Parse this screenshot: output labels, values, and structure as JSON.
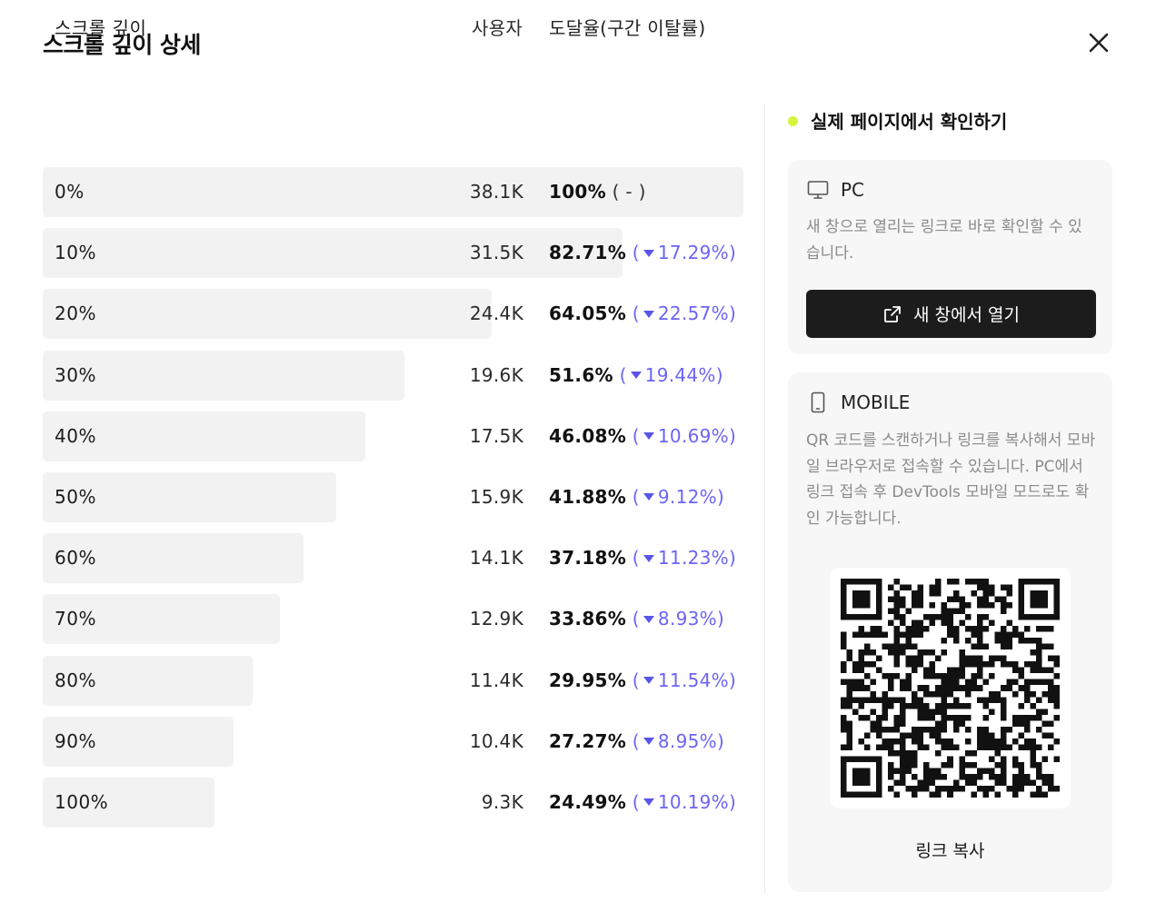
{
  "modal": {
    "title": "스크롤 깊이 상세",
    "close_icon": "close-icon"
  },
  "table": {
    "headers": {
      "depth": "스크롤 깊이",
      "users": "사용자",
      "rate": "도달율(구간 이탈률)"
    },
    "rows": [
      {
        "depth": "0%",
        "users": "38.1K",
        "reach": "100%",
        "drop": "( - )",
        "drop_has_arrow": false,
        "reach_fraction": 1.0
      },
      {
        "depth": "10%",
        "users": "31.5K",
        "reach": "82.71%",
        "drop_open": "(",
        "drop_value": "17.29%",
        "drop_close": ")",
        "drop_has_arrow": true,
        "reach_fraction": 0.8271
      },
      {
        "depth": "20%",
        "users": "24.4K",
        "reach": "64.05%",
        "drop_open": "(",
        "drop_value": "22.57%",
        "drop_close": ")",
        "drop_has_arrow": true,
        "reach_fraction": 0.6405
      },
      {
        "depth": "30%",
        "users": "19.6K",
        "reach": "51.6%",
        "drop_open": "(",
        "drop_value": "19.44%",
        "drop_close": ")",
        "drop_has_arrow": true,
        "reach_fraction": 0.516
      },
      {
        "depth": "40%",
        "users": "17.5K",
        "reach": "46.08%",
        "drop_open": "(",
        "drop_value": "10.69%",
        "drop_close": ")",
        "drop_has_arrow": true,
        "reach_fraction": 0.4608
      },
      {
        "depth": "50%",
        "users": "15.9K",
        "reach": "41.88%",
        "drop_open": "(",
        "drop_value": "9.12%",
        "drop_close": ")",
        "drop_has_arrow": true,
        "reach_fraction": 0.4188
      },
      {
        "depth": "60%",
        "users": "14.1K",
        "reach": "37.18%",
        "drop_open": "(",
        "drop_value": "11.23%",
        "drop_close": ")",
        "drop_has_arrow": true,
        "reach_fraction": 0.3718
      },
      {
        "depth": "70%",
        "users": "12.9K",
        "reach": "33.86%",
        "drop_open": "(",
        "drop_value": "8.93%",
        "drop_close": ")",
        "drop_has_arrow": true,
        "reach_fraction": 0.3386
      },
      {
        "depth": "80%",
        "users": "11.4K",
        "reach": "29.95%",
        "drop_open": "(",
        "drop_value": "11.54%",
        "drop_close": ")",
        "drop_has_arrow": true,
        "reach_fraction": 0.2995
      },
      {
        "depth": "90%",
        "users": "10.4K",
        "reach": "27.27%",
        "drop_open": "(",
        "drop_value": "8.95%",
        "drop_close": ")",
        "drop_has_arrow": true,
        "reach_fraction": 0.2727
      },
      {
        "depth": "100%",
        "users": "9.3K",
        "reach": "24.49%",
        "drop_open": "(",
        "drop_value": "10.19%",
        "drop_close": ")",
        "drop_has_arrow": true,
        "reach_fraction": 0.2449
      }
    ]
  },
  "live_panel": {
    "heading": "실제 페이지에서 확인하기",
    "dot_color": "#d4f53c",
    "pc": {
      "label": "PC",
      "icon": "monitor-icon",
      "description": "새 창으로 열리는 링크로 바로 확인할 수 있습니다.",
      "button_label": "새 창에서 열기",
      "button_icon": "external-link-icon"
    },
    "mobile": {
      "label": "MOBILE",
      "icon": "smartphone-icon",
      "description": "QR 코드를 스캔하거나 링크를 복사해서 모바일 브라우저로 접속할 수 있습니다. PC에서 링크 접속 후 DevTools 모바일 모드로도 확인 가능합니다.",
      "qr_icon": "qr-code-icon",
      "copy_label": "링크 복사"
    }
  },
  "colors": {
    "accent_drop": "#6b64f5",
    "bar_bg": "#f2f2f2",
    "button_bg": "#1c1c1c"
  }
}
